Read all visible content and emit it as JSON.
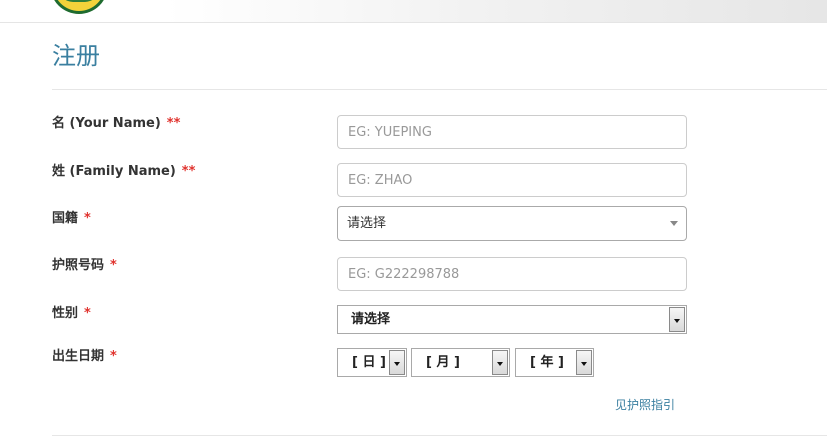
{
  "page_title": "注册",
  "form": {
    "first_name": {
      "label": "名 (Your Name)",
      "required_mark": "**",
      "placeholder": "EG: YUEPING",
      "value": ""
    },
    "family_name": {
      "label": "姓 (Family Name)",
      "required_mark": "**",
      "placeholder": "EG: ZHAO",
      "value": ""
    },
    "nationality": {
      "label": "国籍",
      "required_mark": "*",
      "selected": "请选择"
    },
    "passport": {
      "label": "护照号码",
      "required_mark": "*",
      "placeholder": "EG: G222298788",
      "value": ""
    },
    "gender": {
      "label": "性别",
      "required_mark": "*",
      "selected": "请选择"
    },
    "dob": {
      "label": "出生日期",
      "required_mark": "*",
      "day_selected": "[ 日 ]",
      "month_selected": "[ 月 ]",
      "year_selected": "[ 年 ]"
    }
  },
  "links": {
    "passport_guide": "见护照指引"
  },
  "colors": {
    "title": "#3a7fa0",
    "required": "#e0322d",
    "link": "#3a7fa0"
  }
}
